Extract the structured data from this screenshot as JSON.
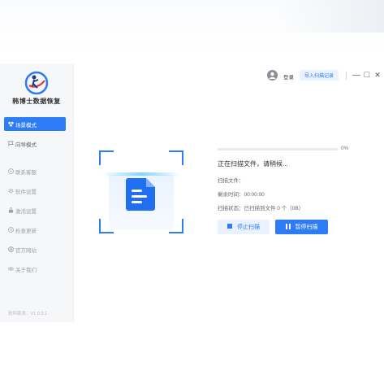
{
  "app": {
    "brand": "韩博士数据恢复"
  },
  "sidebar": {
    "items": [
      {
        "label": "场景模式",
        "icon": "scene-icon",
        "active": true
      },
      {
        "label": "向导模式",
        "icon": "flag-icon"
      },
      {
        "label": "联系客服",
        "icon": "support-icon"
      },
      {
        "label": "软件设置",
        "icon": "settings-icon"
      },
      {
        "label": "激活设置",
        "icon": "activate-icon"
      },
      {
        "label": "检查更新",
        "icon": "update-icon"
      },
      {
        "label": "官方网站",
        "icon": "web-icon"
      },
      {
        "label": "关于我们",
        "icon": "about-icon"
      }
    ],
    "version": "软件版本：V1.0.3.1"
  },
  "topbar": {
    "login": "登录",
    "import": "导入扫描记录",
    "min": "—",
    "max": "□",
    "close": "✕"
  },
  "scan": {
    "progress_pct": 0,
    "progress_text": "0%",
    "status": "正在扫描文件，请稍候...",
    "file_label": "扫描文件：",
    "time_label": "剩余时间：00:00:00",
    "state_label": "扫描状态：已扫描到文件 0 个（0B）"
  },
  "buttons": {
    "stop": "停止扫描",
    "pause": "暂停扫描"
  },
  "colors": {
    "accent": "#2d7cf6",
    "sidebar_bg": "#f6f7f9"
  }
}
